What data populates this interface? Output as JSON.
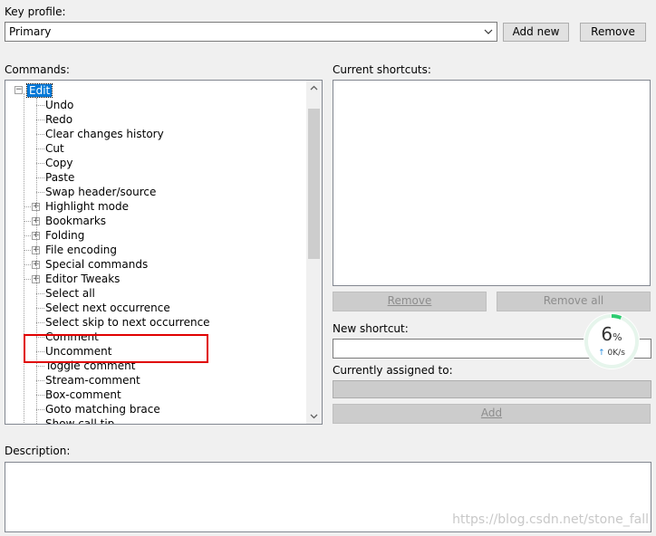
{
  "key_profile": {
    "label": "Key profile:",
    "selected": "Primary",
    "add_new_label": "Add new",
    "remove_label": "Remove"
  },
  "commands": {
    "label": "Commands:",
    "root": "Edit",
    "items": [
      {
        "label": "Undo",
        "expandable": false
      },
      {
        "label": "Redo",
        "expandable": false
      },
      {
        "label": "Clear changes history",
        "expandable": false
      },
      {
        "label": "Cut",
        "expandable": false
      },
      {
        "label": "Copy",
        "expandable": false
      },
      {
        "label": "Paste",
        "expandable": false
      },
      {
        "label": "Swap header/source",
        "expandable": false
      },
      {
        "label": "Highlight mode",
        "expandable": true
      },
      {
        "label": "Bookmarks",
        "expandable": true
      },
      {
        "label": "Folding",
        "expandable": true
      },
      {
        "label": "File encoding",
        "expandable": true
      },
      {
        "label": "Special commands",
        "expandable": true
      },
      {
        "label": "Editor Tweaks",
        "expandable": true
      },
      {
        "label": "Select all",
        "expandable": false
      },
      {
        "label": "Select next occurrence",
        "expandable": false
      },
      {
        "label": "Select skip to next occurrence",
        "expandable": false
      },
      {
        "label": "Comment",
        "expandable": false
      },
      {
        "label": "Uncomment",
        "expandable": false
      },
      {
        "label": "Toggle comment",
        "expandable": false
      },
      {
        "label": "Stream-comment",
        "expandable": false
      },
      {
        "label": "Box-comment",
        "expandable": false
      },
      {
        "label": "Goto matching brace",
        "expandable": false
      },
      {
        "label": "Show call tip",
        "expandable": false
      }
    ]
  },
  "current_shortcuts": {
    "label": "Current shortcuts:",
    "remove_label": "Remove",
    "remove_all_label": "Remove all"
  },
  "new_shortcut": {
    "label": "New shortcut:",
    "value": ""
  },
  "currently_assigned": {
    "label": "Currently assigned to:",
    "value": ""
  },
  "add_label": "Add",
  "description": {
    "label": "Description:",
    "value": ""
  },
  "overlay": {
    "percent": "6",
    "percent_unit": "%",
    "speed": "0K/s",
    "accent_color": "#2ecc71"
  },
  "watermark": "https://blog.csdn.net/stone_fall"
}
